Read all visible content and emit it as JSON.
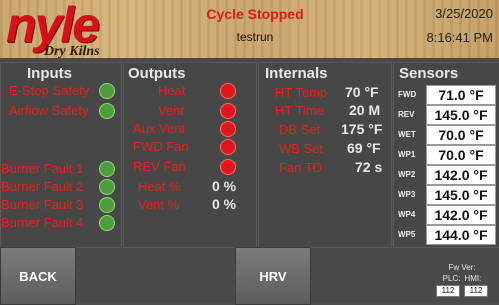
{
  "header": {
    "brand": "nyle",
    "brand_sub": "Dry Kilns",
    "status": "Cycle Stopped",
    "recipe": "testrun",
    "date": "3/25/2020",
    "time": "8:16:41 PM"
  },
  "sections": {
    "inputs": "Inputs",
    "outputs": "Outputs",
    "internals": "Internals",
    "sensors": "Sensors"
  },
  "inputs": [
    {
      "label": "E-Stop Safety",
      "state": "on"
    },
    {
      "label": "Airflow Safety",
      "state": "on"
    },
    {
      "label": "Burner Fault 1",
      "state": "on"
    },
    {
      "label": "Burner Fault 2",
      "state": "on"
    },
    {
      "label": "Burner Fault 3",
      "state": "on"
    },
    {
      "label": "Burner Fault 4",
      "state": "on"
    }
  ],
  "outputs": [
    {
      "label": "Heat",
      "state": "off"
    },
    {
      "label": "Vent",
      "state": "off"
    },
    {
      "label": "Aux Vent",
      "state": "off"
    },
    {
      "label": "FWD Fan",
      "state": "off"
    },
    {
      "label": "REV Fan",
      "state": "off"
    },
    {
      "label": "Heat %",
      "value": "0 %"
    },
    {
      "label": "Vent %",
      "value": "0 %"
    }
  ],
  "internals": [
    {
      "label": "HT Temp",
      "value": "70 °F"
    },
    {
      "label": "HT Time",
      "value": "20 M"
    },
    {
      "label": "DB Set",
      "value": "175 °F"
    },
    {
      "label": "WB Set",
      "value": "69 °F"
    },
    {
      "label": "Fan TD",
      "value": "72 s"
    }
  ],
  "sensors": [
    {
      "tag": "FWD",
      "value": "71.0 °F"
    },
    {
      "tag": "REV",
      "value": "145.0 °F"
    },
    {
      "tag": "WET",
      "value": "70.0 °F"
    },
    {
      "tag": "WP1",
      "value": "70.0 °F"
    },
    {
      "tag": "WP2",
      "value": "142.0 °F"
    },
    {
      "tag": "WP3",
      "value": "145.0 °F"
    },
    {
      "tag": "WP4",
      "value": "142.0 °F"
    },
    {
      "tag": "WP5",
      "value": "144.0 °F"
    }
  ],
  "buttons": {
    "back": "BACK",
    "hrv": "HRV"
  },
  "firmware": {
    "title": "Fw Ver:",
    "plc_label": "PLC:",
    "hmi_label": "HMI:",
    "plc": "112",
    "hmi": "112"
  },
  "colors": {
    "label_red": "#e0251a",
    "indicator_green": "#4d9e3b",
    "indicator_red": "#e0141a"
  }
}
